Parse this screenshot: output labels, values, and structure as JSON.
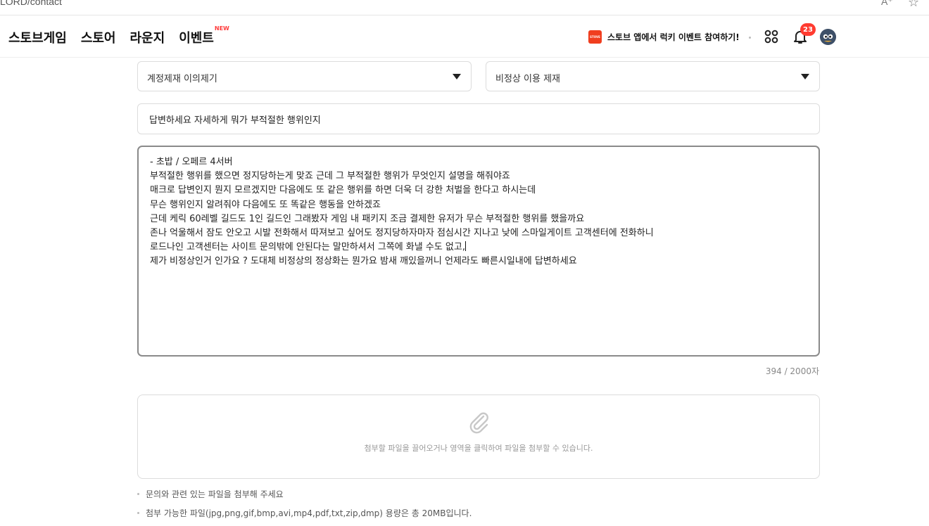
{
  "browser": {
    "url": "LORD/contact",
    "reader_icon_text": "A⁺",
    "favorite_icon": "star-icon"
  },
  "gnb": {
    "menu": [
      {
        "label": "스토브게임"
      },
      {
        "label": "스토어"
      },
      {
        "label": "라운지"
      },
      {
        "label": "이벤트",
        "badge": "NEW"
      }
    ],
    "promo": {
      "logo_text": "STOVE",
      "text": "스토브 앱에서 럭키 이벤트 참여하기!"
    },
    "apps_icon": "grid-apps-icon",
    "notification": {
      "icon": "bell-icon",
      "count": "23"
    },
    "avatar_icon": "profile-avatar-icon"
  },
  "form": {
    "category_primary": "계정제재 이의제기",
    "category_secondary": "비정상 이용 제재",
    "title_value": "답변하세요 자세하게 뭐가 부적절한 행위인지",
    "body_lines": [
      "- 초밥 / 오페르 4서버",
      "부적절한 행위를 했으면 정지당하는게 맞죠 근데 그 부적절한 행위가 무엇인지 설명을 해줘야죠",
      "매크로 답변인지 뭔지 모르겠지만 다음에도 또 같은 행위를 하면 더욱 더 강한 처벌을 한다고 하시는데",
      "무슨 행위인지 알려줘야 다음에도 또 똑같은 행동을 안하겠죠",
      "근데 케릭 60레벨 길드도 1인 길드인 그래봤자 게임 내 패키지 조금 결제한 유저가 무슨 부적절한 행위를 했을까요",
      "존나 억울해서 잠도 안오고 시발 전화해서 따져보고 싶어도 정지당하자마자 점심시간 지나고 낮에 스마일게이트 고객센터에 전화하니",
      "로드나인 고객센터는 사이트 문의밖에 안된다는 말만하셔서 그쪽에 화낼 수도 없고,",
      "제가 비정상인거 인가요 ? 도대체 비정상의 정상화는 뭔가요 밤새 깨있을꺼니 언제라도 빠른시일내에 답변하세요"
    ],
    "char_count": "394 / 2000자",
    "attach_hint": "첨부할 파일을 끌어오거나 영역을 클릭하여 파일을 첨부할 수 있습니다.",
    "notes": [
      "문의와 관련 있는 파일을 첨부해 주세요",
      "첨부 가능한 파일(jpg,png,gif,bmp,avi,mp4,pdf,txt,zip,dmp) 용량은 총 20MB입니다."
    ]
  },
  "colors": {
    "accent_red": "#ff3b30",
    "promo_logo": "#f03e1f",
    "border": "#dcdcdc",
    "focused_border": "#8a8a8a"
  }
}
